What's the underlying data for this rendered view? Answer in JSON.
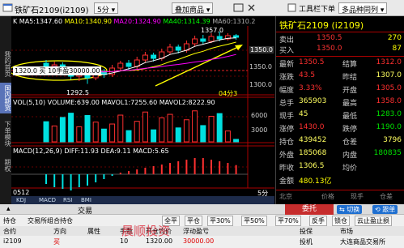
{
  "titlebar": {
    "title": "铁矿石2109(i2109)",
    "period": "5分",
    "overlay_btn": "叠加商品",
    "toolbar_label": "工具栏下单",
    "layout_dropdown": "多品种同列"
  },
  "sidenav": [
    "我的首页",
    "国内期货",
    "下单模块",
    "期权"
  ],
  "chart": {
    "ma_line": {
      "k": "K",
      "ma5": "MA5:1347.60",
      "ma10": "MA10:1340.90",
      "ma20": "MA20:1324.90",
      "ma40": "MA40:1314.39",
      "ma60": "MA60:1310.2"
    },
    "high_mark": "1357.0",
    "price_label": "1350.0",
    "low_mark": "1292.5",
    "position_tag": "1320.0 买 10手盈30000.00",
    "label_04": "04分3",
    "y_ticks": [
      "1350.0",
      "1300.0"
    ],
    "vol_line": "VOL(5,10) VOLUME:639.00 MAVOL1:7255.60 MAVOL2:8222.90",
    "vol_ticks": [
      "6000",
      "3000"
    ],
    "macd_line": "MACD(12,26,9) DIFF:11.93 DEA:9.11 MACD:5.65",
    "x_left": "0512",
    "x_right": "5分",
    "bottom_tabs": [
      "KDJ",
      "MACD",
      "RSI",
      "BMI"
    ],
    "candles": [
      {
        "o": 1318,
        "c": 1312,
        "h": 1322,
        "l": 1306
      },
      {
        "o": 1312,
        "c": 1316,
        "h": 1320,
        "l": 1308
      },
      {
        "o": 1316,
        "c": 1310,
        "h": 1319,
        "l": 1304
      },
      {
        "o": 1310,
        "c": 1302,
        "h": 1313,
        "l": 1298
      },
      {
        "o": 1302,
        "c": 1306,
        "h": 1310,
        "l": 1296
      },
      {
        "o": 1306,
        "c": 1300,
        "h": 1309,
        "l": 1292.5
      },
      {
        "o": 1300,
        "c": 1308,
        "h": 1312,
        "l": 1297
      },
      {
        "o": 1308,
        "c": 1304,
        "h": 1311,
        "l": 1300
      },
      {
        "o": 1304,
        "c": 1312,
        "h": 1316,
        "l": 1301
      },
      {
        "o": 1312,
        "c": 1318,
        "h": 1321,
        "l": 1309
      },
      {
        "o": 1318,
        "c": 1314,
        "h": 1322,
        "l": 1310
      },
      {
        "o": 1314,
        "c": 1322,
        "h": 1326,
        "l": 1311
      },
      {
        "o": 1322,
        "c": 1328,
        "h": 1332,
        "l": 1319
      },
      {
        "o": 1328,
        "c": 1324,
        "h": 1331,
        "l": 1320
      },
      {
        "o": 1324,
        "c": 1332,
        "h": 1336,
        "l": 1321
      },
      {
        "o": 1332,
        "c": 1338,
        "h": 1342,
        "l": 1329
      },
      {
        "o": 1338,
        "c": 1334,
        "h": 1341,
        "l": 1330
      },
      {
        "o": 1334,
        "c": 1342,
        "h": 1346,
        "l": 1331
      },
      {
        "o": 1342,
        "c": 1348,
        "h": 1352,
        "l": 1339
      },
      {
        "o": 1348,
        "c": 1345,
        "h": 1353,
        "l": 1341
      },
      {
        "o": 1345,
        "c": 1351,
        "h": 1355,
        "l": 1343
      },
      {
        "o": 1351,
        "c": 1348,
        "h": 1357,
        "l": 1345
      },
      {
        "o": 1348,
        "c": 1352,
        "h": 1355,
        "l": 1346
      },
      {
        "o": 1352,
        "c": 1350,
        "h": 1354,
        "l": 1347
      }
    ],
    "volumes": [
      5200,
      4100,
      6300,
      7400,
      3900,
      6800,
      5100,
      3300,
      4600,
      6900,
      2900,
      5300,
      7700,
      3100,
      6200,
      7100,
      3600,
      5700,
      8000,
      4200,
      6600,
      7300,
      2800,
      639
    ],
    "macd": [
      -6,
      -8,
      -9,
      -10,
      -8,
      -7,
      -5,
      -3,
      -1,
      1,
      2,
      3,
      4,
      5,
      6,
      7,
      8,
      9,
      10,
      10,
      9,
      8,
      7,
      5.65
    ]
  },
  "quote": {
    "name": "铁矿石2109 (i2109)",
    "sell": {
      "label": "卖出",
      "price": "1350.5",
      "vol": "270"
    },
    "buy": {
      "label": "买入",
      "price": "1350.0",
      "vol": "87"
    },
    "rows": [
      {
        "l1": "最新",
        "v1": "1350.5",
        "l2": "结算",
        "v2": "1312.0"
      },
      {
        "l1": "涨跌",
        "v1": "43.5",
        "l2": "昨结",
        "v2": "1307.0"
      },
      {
        "l1": "幅度",
        "v1": "3.33%",
        "l2": "开盘",
        "v2": "1305.0"
      },
      {
        "l1": "总手",
        "v1": "365903",
        "l2": "最高",
        "v2": "1358.0"
      },
      {
        "l1": "现手",
        "v1": "45",
        "l2": "最低",
        "v2": "1283.0"
      },
      {
        "l1": "涨停",
        "v1": "1430.0",
        "l2": "跌停",
        "v2": "1190.0"
      },
      {
        "l1": "持仓",
        "v1": "439452",
        "l2": "仓差",
        "v2": "3796"
      },
      {
        "l1": "外盘",
        "v1": "185068",
        "l2": "内盘",
        "v2": "180835"
      },
      {
        "l1": "昨收",
        "v1": "1306.5",
        "l2": "均价",
        "v2": ""
      },
      {
        "l1": "金额",
        "v1": "480.13亿",
        "l2": "",
        "v2": ""
      }
    ],
    "footer_cols": [
      "北京",
      "价格",
      "现手",
      "仓差"
    ]
  },
  "trade": {
    "title": "交易",
    "toolbar": [
      "全平",
      "平仓",
      "平30%",
      "平50%",
      "平70%",
      "反手",
      "锁仓",
      "云止盈止损"
    ],
    "tabs": [
      "持仓",
      "交易所组合持仓"
    ],
    "headers": [
      "合约",
      "方向",
      "属性",
      "手数",
      "开仓均价",
      "浮动盈亏",
      "投保",
      "市场"
    ],
    "row": [
      "i2109",
      "买",
      "",
      "10",
      "1320.00",
      "30000.00",
      "投机",
      "大连商品交易所"
    ],
    "right_buttons": [
      "切换",
      "跟单"
    ],
    "tab_entrust": "委托",
    "watermark": "晨顺投资"
  }
}
